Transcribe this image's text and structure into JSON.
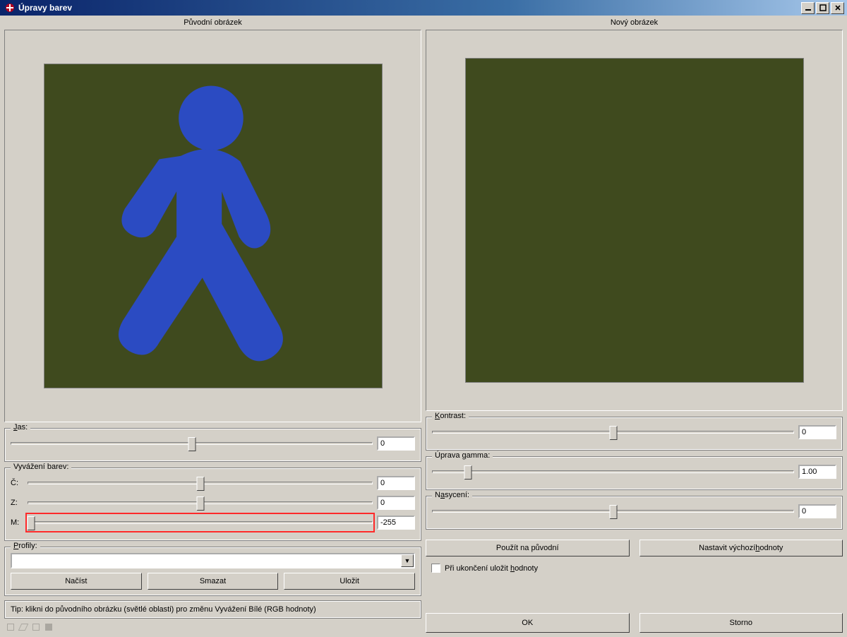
{
  "window": {
    "title": "Úpravy barev"
  },
  "preview": {
    "original_label": "Původní obrázek",
    "new_label": "Nový obrázek"
  },
  "sliders": {
    "jas": {
      "label": "Jas:",
      "value": "0",
      "thumb_pct": 50
    },
    "balance": {
      "label": "Vyvážení barev:"
    },
    "c": {
      "label": "Č:",
      "value": "0",
      "thumb_pct": 50
    },
    "z": {
      "label": "Z:",
      "value": "0",
      "thumb_pct": 50
    },
    "m": {
      "label": "M:",
      "value": "-255",
      "thumb_pct": 1,
      "highlight": true
    },
    "kontrast": {
      "label": "Kontrast:",
      "value": "0",
      "thumb_pct": 50
    },
    "gamma": {
      "label": "Úprava gamma:",
      "value": "1.00",
      "thumb_pct": 10
    },
    "nasyceni": {
      "label": "Nasycení:",
      "value": "0",
      "thumb_pct": 50
    }
  },
  "profiles": {
    "label": "Profily:",
    "selected": "",
    "load": "Načíst",
    "delete": "Smazat",
    "save": "Uložit"
  },
  "actions": {
    "apply": "Použít na původní",
    "reset": "Nastavit výchozí hodnoty"
  },
  "checkbox": {
    "label": "Při ukončení uložit hodnoty",
    "checked": false
  },
  "tip": "Tip: klikni do původního obrázku (světlé oblasti) pro změnu Vyvážení Bílé (RGB hodnoty)",
  "dialog": {
    "ok": "OK",
    "cancel": "Storno"
  },
  "colors": {
    "preview_bg": "#3f4a1e",
    "figure": "#2b4bc2"
  }
}
